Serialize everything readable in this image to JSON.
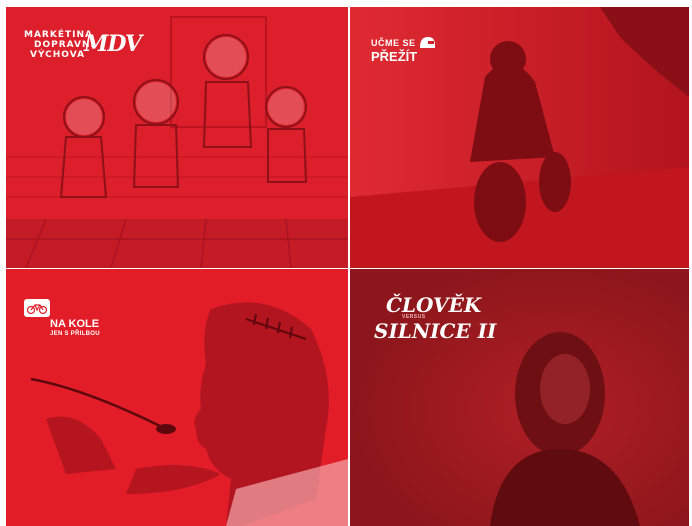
{
  "tiles": [
    {
      "logo": [
        "MARKÉTINA",
        "DOPRAVNÍ",
        "VÝCHOVA",
        "MDV"
      ]
    },
    {
      "logo": [
        "UČME SE",
        "PŘEŽÍT"
      ],
      "icon": "helmet-icon"
    },
    {
      "logo": [
        "NA KOLE",
        "JEN S PŘILBOU"
      ],
      "icon": "bicycle-icon"
    },
    {
      "logo": [
        "ČLOVĚK",
        "VERSUS",
        "SILNICE II"
      ]
    }
  ],
  "colors": {
    "tile1": "#dc1f2b",
    "tile2": "#d21b25",
    "tile3": "#e31d28",
    "tile4": "#9f1a1f"
  }
}
